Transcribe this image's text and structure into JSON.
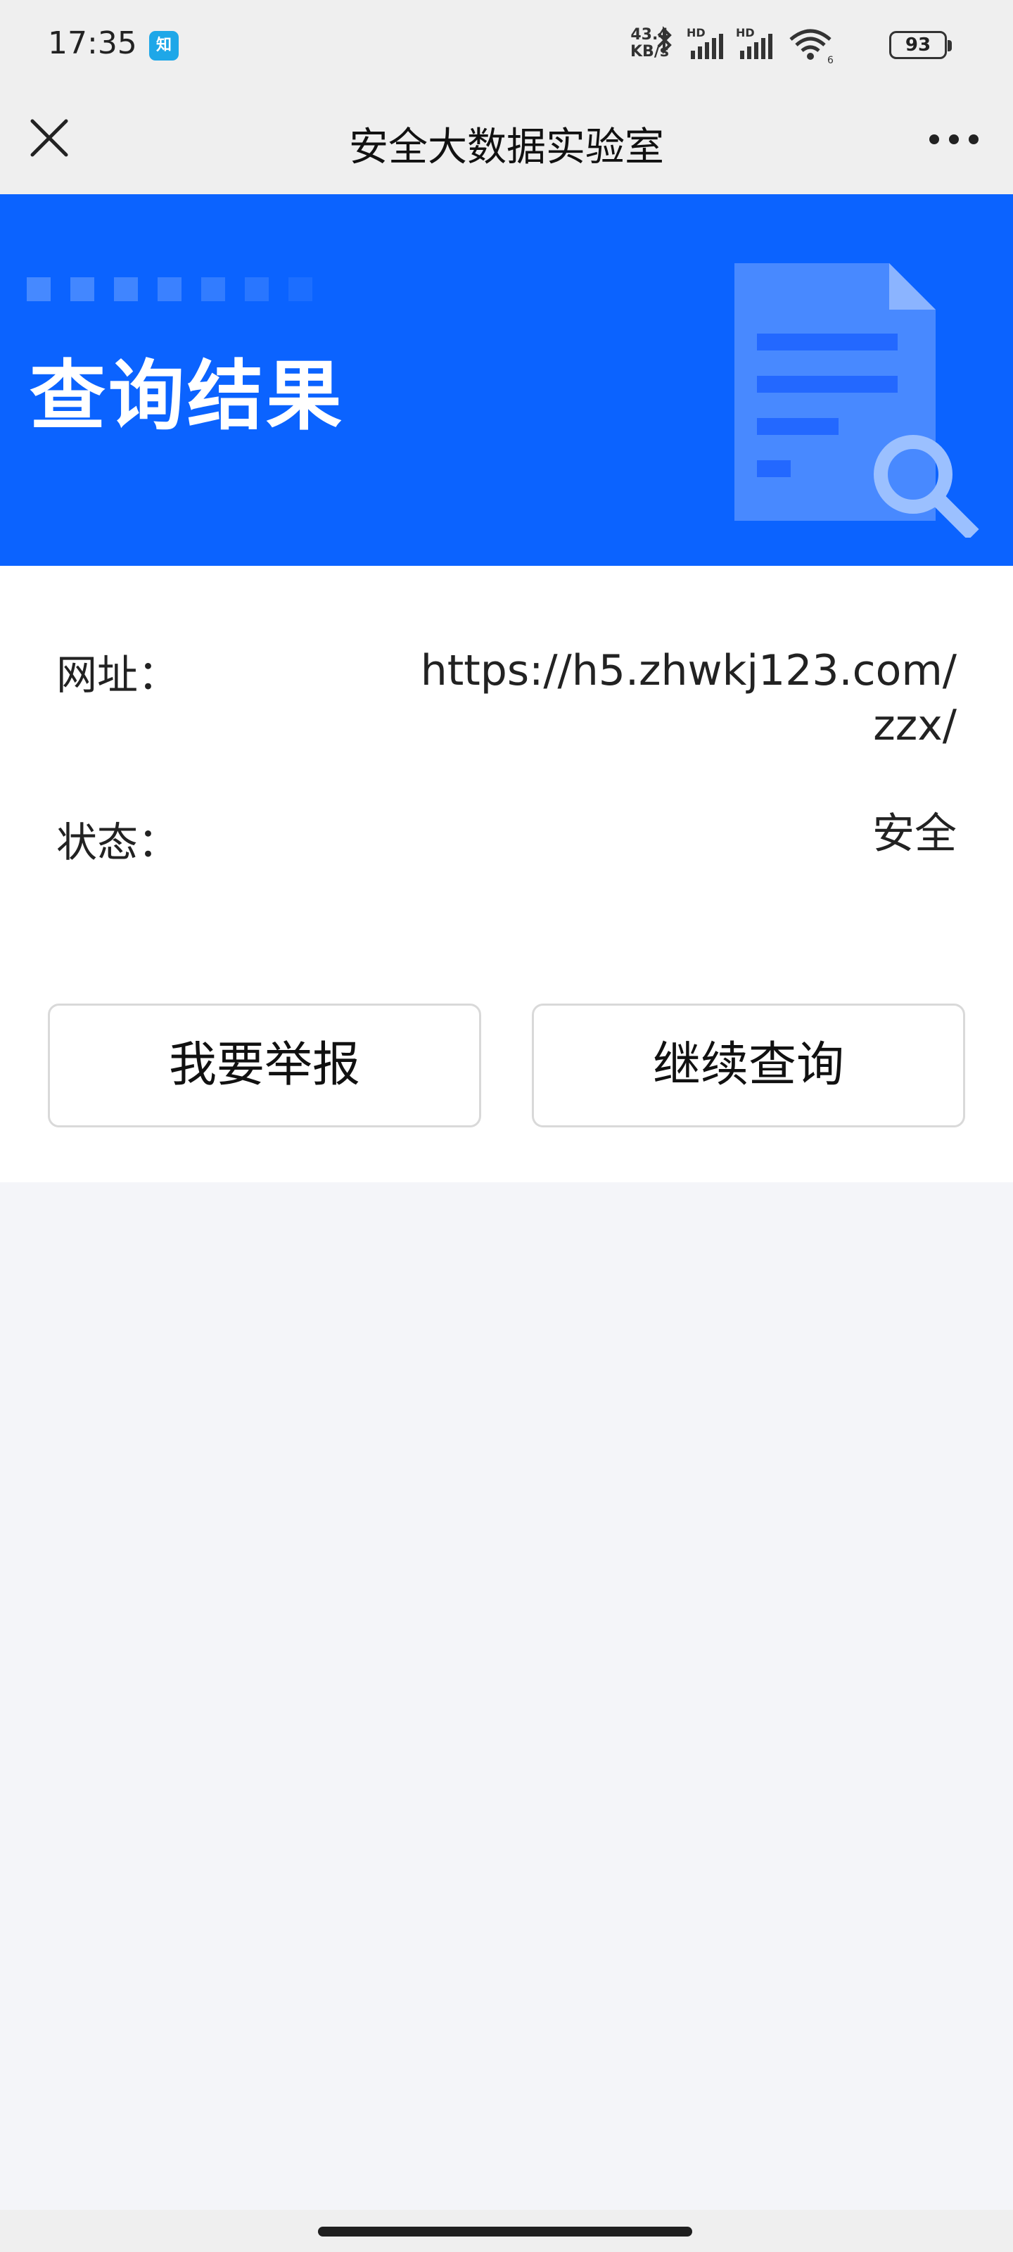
{
  "status_bar": {
    "time": "17:35",
    "app_badge": "知",
    "net_speed_value": "43.4",
    "net_speed_unit": "KB/s",
    "network_label_1": "HD",
    "network_label_2": "HD",
    "wifi_label": "6",
    "battery": "93",
    "icons": [
      "bluetooth-icon",
      "signal-icon",
      "signal-icon",
      "wifi-icon",
      "battery-icon"
    ]
  },
  "nav": {
    "title": "安全大数据实验室",
    "close_icon": "close-icon",
    "more_icon": "more-icon"
  },
  "hero": {
    "title": "查询结果",
    "accent_color": "#0b63ff",
    "icon": "document-search-icon"
  },
  "result": {
    "url_label": "网址：",
    "url_value_line1": "https://h5.zhwkj123.com/",
    "url_value_line2": "zzx/",
    "status_label": "状态：",
    "status_value": "安全"
  },
  "actions": {
    "report_label": "我要举报",
    "continue_label": "继续查询"
  }
}
